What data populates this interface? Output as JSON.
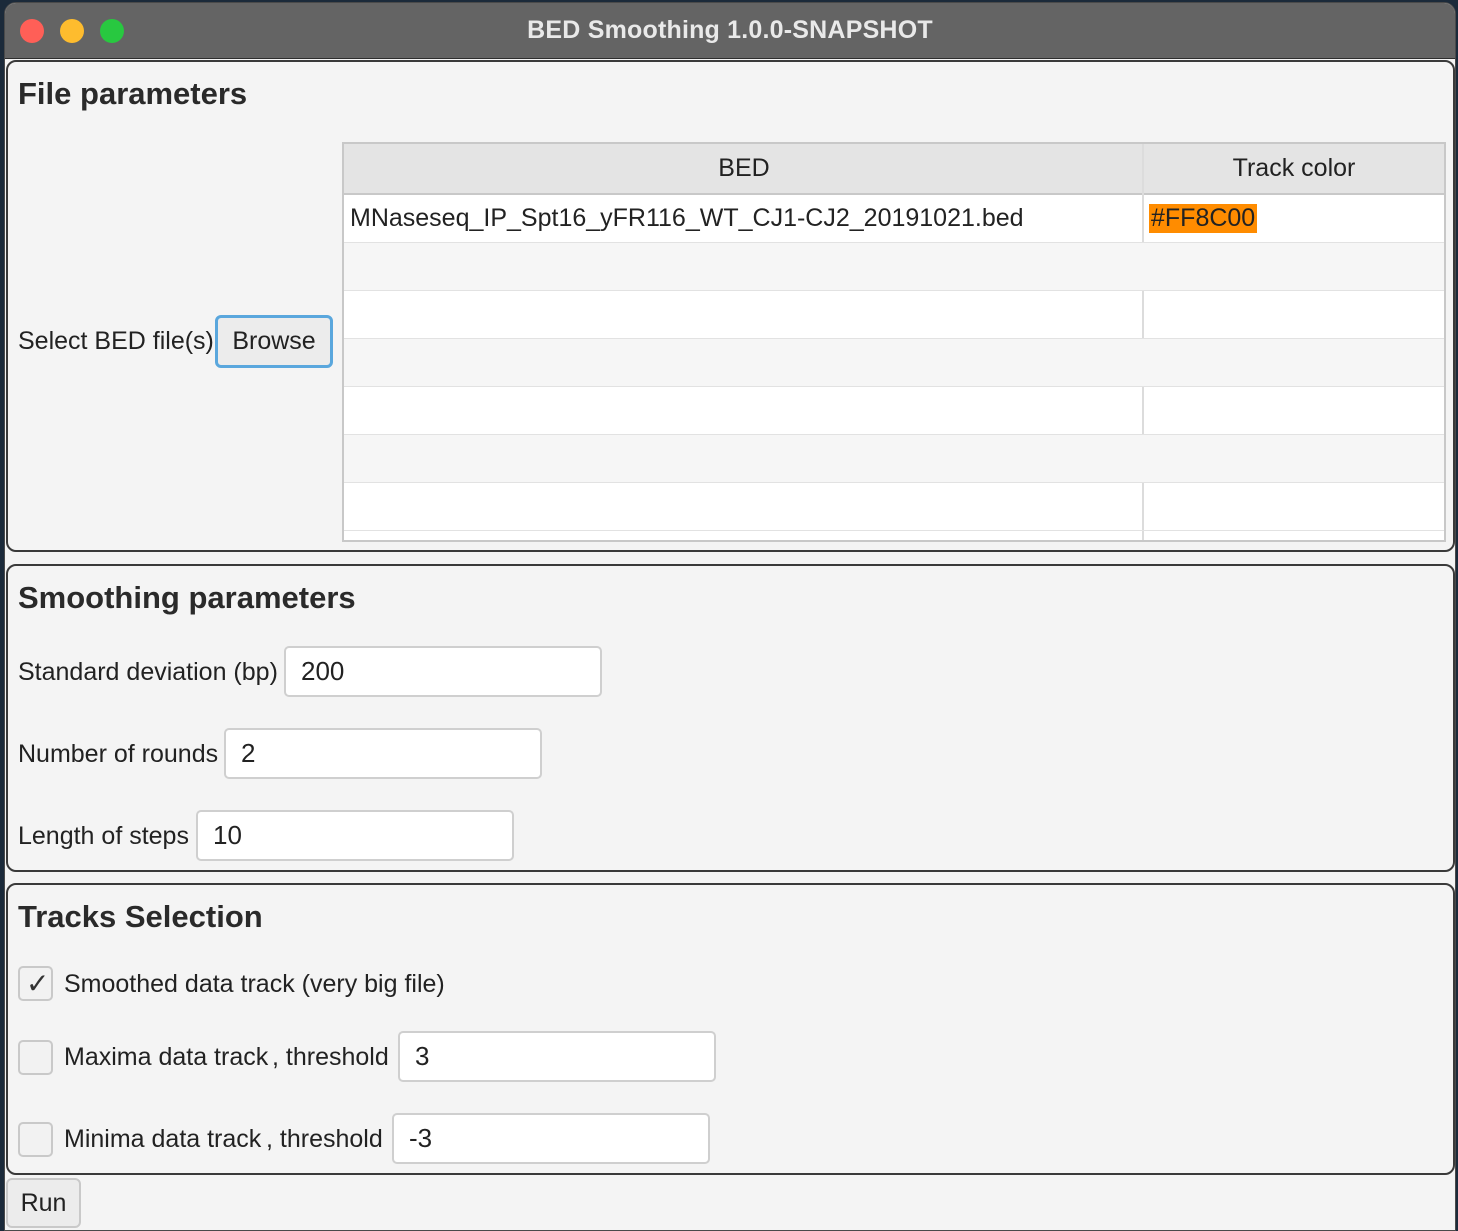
{
  "window": {
    "title": "BED Smoothing 1.0.0-SNAPSHOT"
  },
  "file_params": {
    "heading": "File parameters",
    "select_label": "Select BED file(s)",
    "browse_label": "Browse",
    "table": {
      "columns": [
        "BED",
        "Track color"
      ],
      "rows": [
        {
          "bed": "MNaseseq_IP_Spt16_yFR116_WT_CJ1-CJ2_20191021.bed",
          "color": "#FF8C00"
        }
      ]
    }
  },
  "smoothing": {
    "heading": "Smoothing parameters",
    "std_label": "Standard deviation (bp)",
    "std_value": "200",
    "rounds_label": "Number of rounds",
    "rounds_value": "2",
    "steps_label": "Length of steps",
    "steps_value": "10"
  },
  "tracks": {
    "heading": "Tracks Selection",
    "smoothed_label": "Smoothed data track (very big file)",
    "smoothed_checked": true,
    "maxima_label": "Maxima data track",
    "maxima_threshold_label": ", threshold",
    "maxima_value": "3",
    "minima_label": "Minima data track",
    "minima_threshold_label": ", threshold",
    "minima_value": "-3"
  },
  "actions": {
    "run_label": "Run"
  },
  "colors": {
    "track_color": "#FF8C00"
  }
}
